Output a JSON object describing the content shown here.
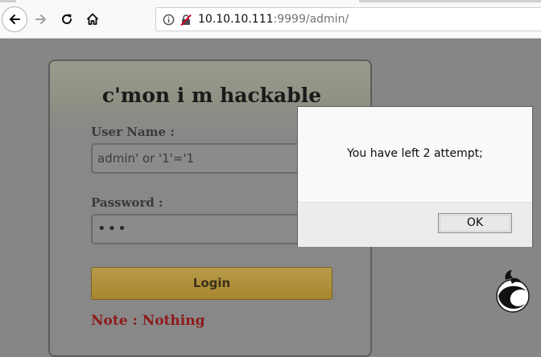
{
  "browser": {
    "url_host": "10.10.10.111",
    "url_rest": ":9999/admin/",
    "icons": {
      "back": "back-arrow-icon",
      "forward": "forward-arrow-icon",
      "reload": "reload-icon",
      "home": "home-icon",
      "info": "info-icon",
      "insecure": "insecure-connection-icon"
    }
  },
  "page": {
    "title": "c'mon i m hackable",
    "username_label": "User Name :",
    "username_value": "admin' or '1'='1",
    "password_label": "Password :",
    "password_value": "•••",
    "login_label": "Login",
    "note": "Note : Nothing"
  },
  "dialog": {
    "message": "You have left 2 attempt;",
    "ok_label": "OK"
  },
  "colors": {
    "overlay": "#868686",
    "button_gold": "#a8862e",
    "note_red": "#8e1a1a"
  }
}
